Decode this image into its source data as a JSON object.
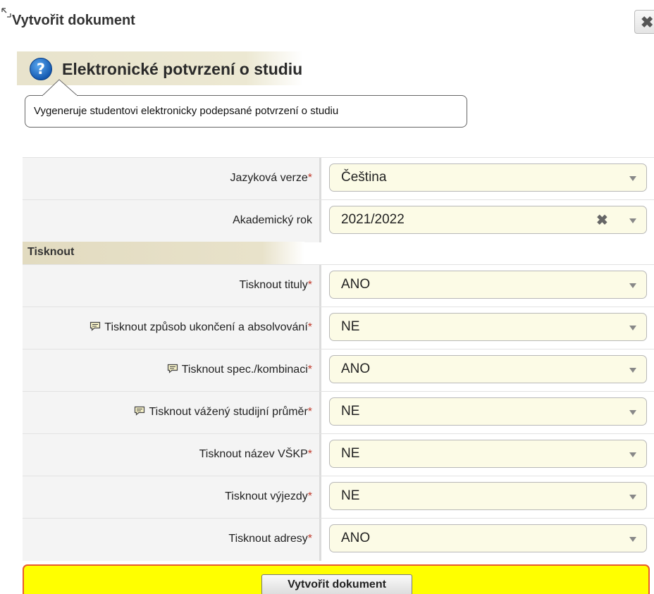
{
  "dialog": {
    "title": "Vytvořit dokument",
    "close_symbol": "✖"
  },
  "header": {
    "title": "Elektronické potvrzení o studiu",
    "tooltip": "Vygeneruje studentovi elektronicky podepsané potvrzení o studiu"
  },
  "fields": [
    {
      "label": "Jazyková verze",
      "required": "*",
      "value": "Čeština"
    },
    {
      "label": "Akademický rok",
      "required": "",
      "value": "2021/2022",
      "clear_symbol": "✖"
    }
  ],
  "section": {
    "title": "Tisknout"
  },
  "print_fields": [
    {
      "label": "Tisknout tituly",
      "required": "*",
      "value": "ANO"
    },
    {
      "label": "Tisknout způsob ukončení a absolvování",
      "required": "*",
      "value": "NE",
      "icon": "comment-icon"
    },
    {
      "label": "Tisknout spec./kombinaci",
      "required": "*",
      "value": "ANO",
      "icon": "comment-icon"
    },
    {
      "label": "Tisknout vážený studijní průměr",
      "required": "*",
      "value": "NE",
      "icon": "comment-icon"
    },
    {
      "label": "Tisknout název VŠKP",
      "required": "*",
      "value": "NE"
    },
    {
      "label": "Tisknout výjezdy",
      "required": "*",
      "value": "NE"
    },
    {
      "label": "Tisknout adresy",
      "required": "*",
      "value": "ANO"
    }
  ],
  "submit": {
    "label": "Vytvořit dokument"
  },
  "colors": {
    "select_bg": "#fcfbe6",
    "required": "#c0392b",
    "submit_bar": "#ffff00",
    "submit_border": "#e85c2c",
    "header_band": "#e8e3cc"
  }
}
